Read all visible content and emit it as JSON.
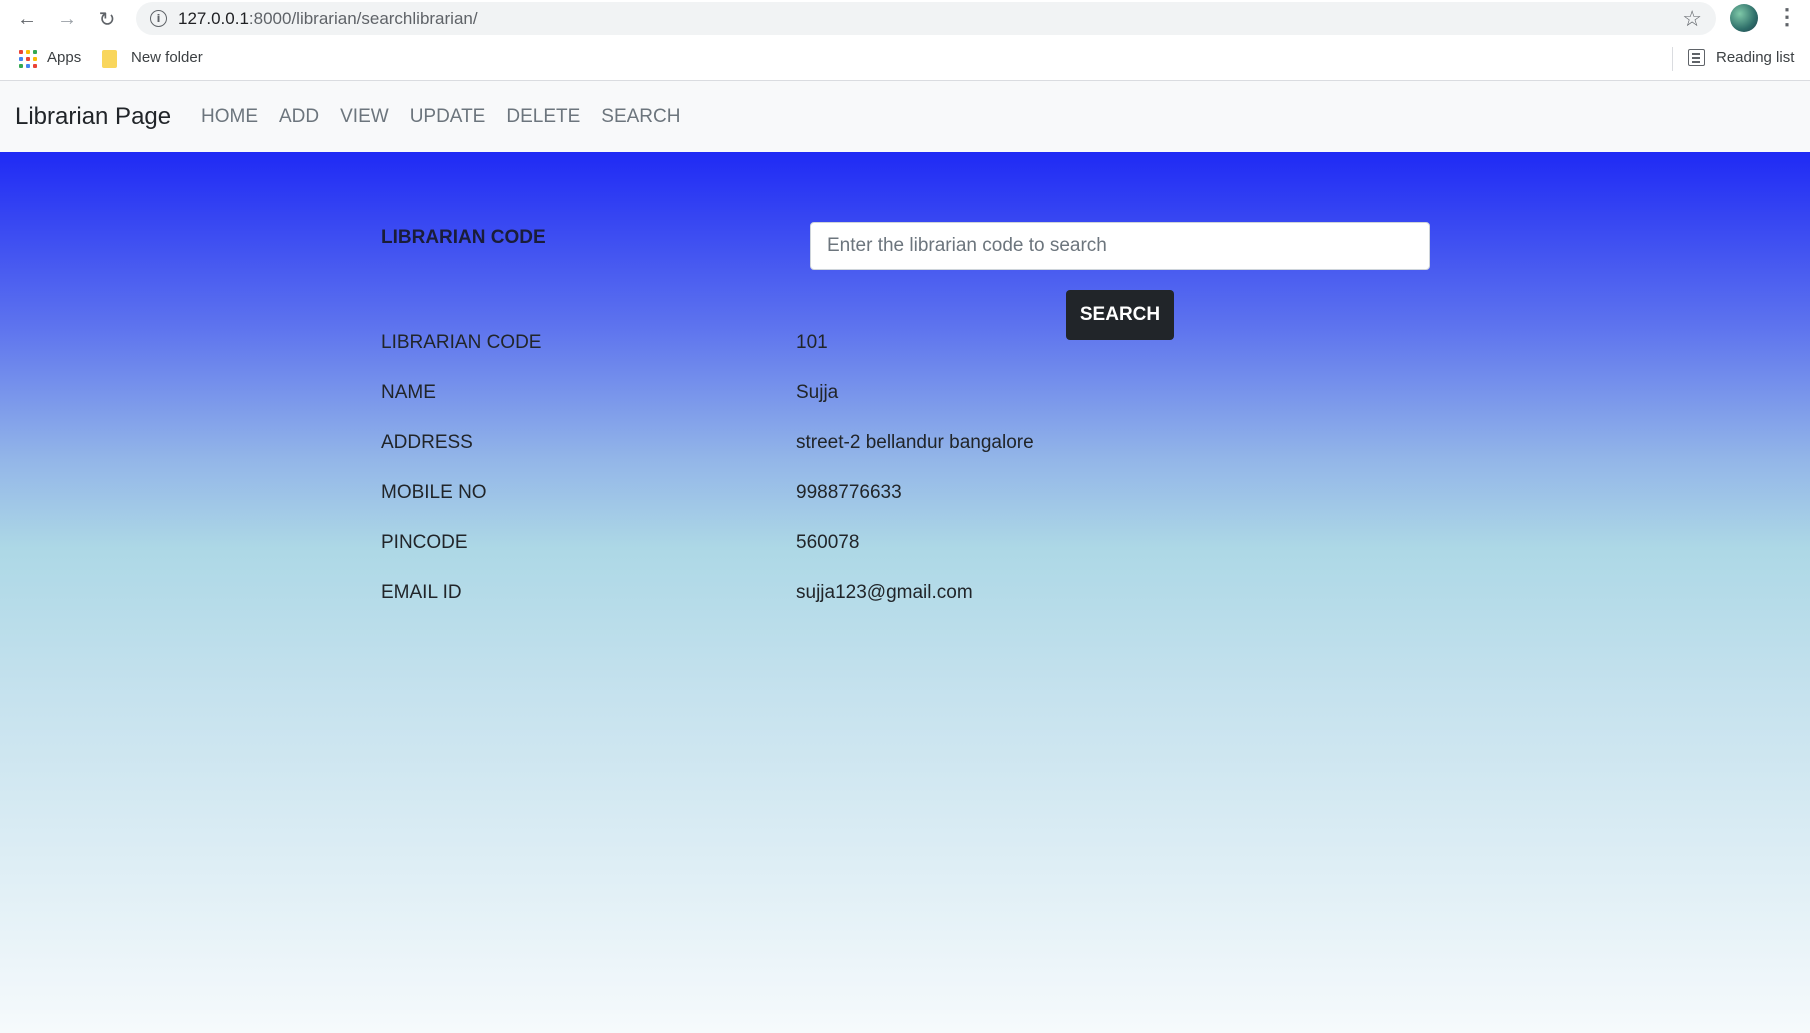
{
  "browser": {
    "url_host": "127.0.0.1",
    "url_rest": ":8000/librarian/searchlibrarian/",
    "bookmarks": [
      {
        "label": "Apps"
      },
      {
        "label": "New folder"
      }
    ],
    "reading_list_label": "Reading list"
  },
  "navbar": {
    "brand": "Librarian Page",
    "links": [
      "HOME",
      "ADD",
      "VIEW",
      "UPDATE",
      "DELETE",
      "SEARCH"
    ]
  },
  "search": {
    "label": "LIBRARIAN CODE",
    "placeholder": "Enter the librarian code to search",
    "value": "",
    "button_label": "SEARCH"
  },
  "result": {
    "rows": [
      {
        "label": "LIBRARIAN CODE",
        "value": "101"
      },
      {
        "label": "NAME",
        "value": "Sujja"
      },
      {
        "label": "ADDRESS",
        "value": "street-2 bellandur bangalore"
      },
      {
        "label": "MOBILE NO",
        "value": "9988776633"
      },
      {
        "label": "PINCODE",
        "value": "560078"
      },
      {
        "label": "EMAIL ID",
        "value": "sujja123@gmail.com"
      }
    ]
  },
  "colors": {
    "gradient_top": "#1f2af5",
    "gradient_mid": "#add8e6",
    "gradient_bottom": "#f6fafc",
    "button_bg": "#212529"
  },
  "icons": [
    "back-arrow-icon",
    "forward-arrow-icon",
    "reload-icon",
    "site-info-icon",
    "bookmark-star-icon",
    "apps-grid-icon",
    "folder-icon",
    "reading-list-icon",
    "profile-avatar-icon",
    "more-menu-icon"
  ]
}
